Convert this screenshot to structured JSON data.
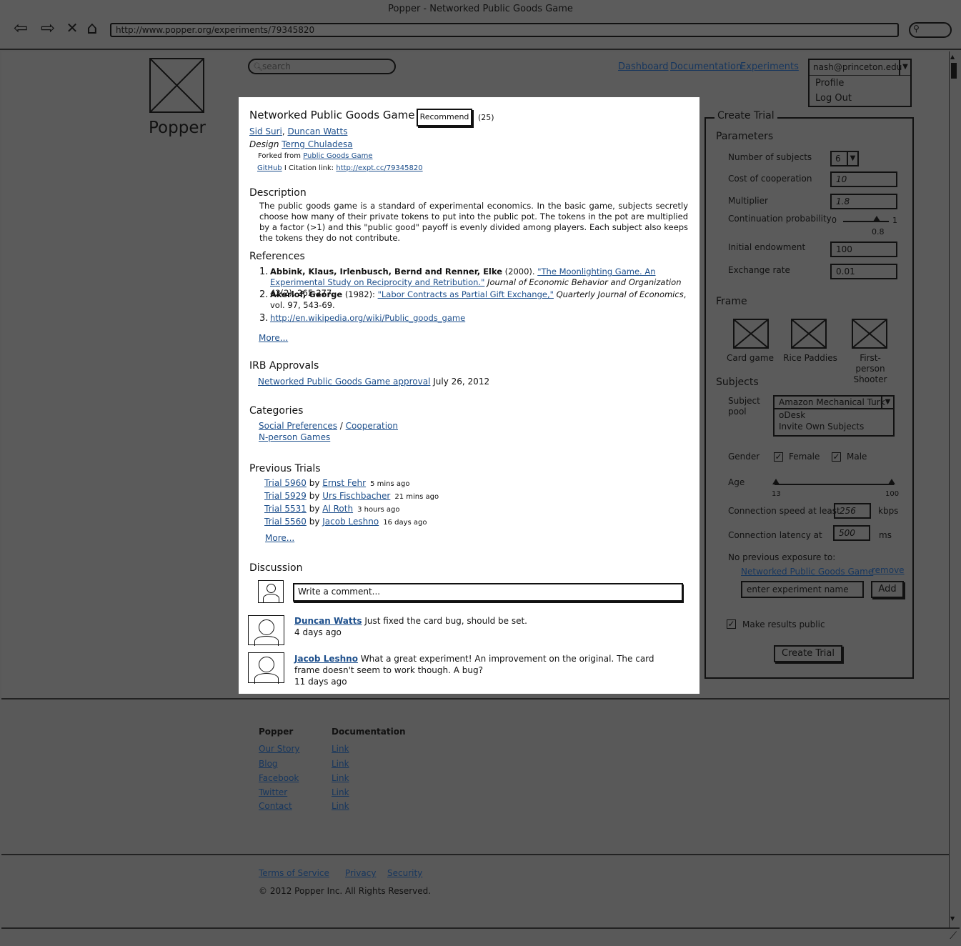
{
  "window": {
    "title": "Popper - Networked Public Goods Game",
    "url": "http://www.popper.org/experiments/79345820"
  },
  "site": {
    "name": "Popper",
    "search_placeholder": "search",
    "nav": [
      "Dashboard",
      "Documentation",
      "Experiments"
    ],
    "user": {
      "email": "nash@princeton.edu",
      "menu": [
        "Profile",
        "Log Out"
      ]
    }
  },
  "experiment": {
    "title": "Networked Public Goods Game",
    "recommend_label": "Recommend",
    "recommend_count": "(25)",
    "authors": [
      "Sid Suri",
      "Duncan Watts"
    ],
    "design_label": "Design",
    "designer": "Terng Chuladesa",
    "forked_label": "Forked from",
    "forked_from": "Public Goods Game",
    "github": "GitHub",
    "citation_label": "I Citation link:",
    "citation_url": "http://expt.cc/79345820",
    "description_heading": "Description",
    "description": "The public goods game is a standard of experimental economics. In the basic game, subjects secretly choose how many of their private tokens to put into the public pot. The tokens in the pot are multiplied by a factor (>1) and this \"public good\" payoff is evenly divided among players. Each subject also keeps the tokens they do not contribute.",
    "references_heading": "References",
    "references": [
      {
        "num": "1.",
        "authors": "Abbink, Klaus, Irlenbusch, Bernd and Renner, Elke",
        "year": "(2000).",
        "title": "\"The Moonlighting Game. An Experimental Study on Reciprocity and Retribution.\"",
        "journal": "Journal of Economic Behavior and Organization",
        "rest": "42(2), 265-277."
      },
      {
        "num": "2.",
        "authors": "Akerlof, George",
        "year": "(1982):",
        "title": "\"Labor Contracts as Partial Gift Exchange,\"",
        "journal": "Quarterly Journal of Economics",
        "rest": ", vol. 97, 543-69."
      },
      {
        "num": "3.",
        "url": "http://en.wikipedia.org/wiki/Public_goods_game"
      }
    ],
    "more_label": "More...",
    "irb_heading": "IRB Approvals",
    "irb_link": "Networked Public Goods Game approval",
    "irb_date": "July 26, 2012",
    "categories_heading": "Categories",
    "categories": [
      "Social Preferences",
      "Cooperation",
      "N-person Games"
    ],
    "categories_sep": "/",
    "trials_heading": "Previous Trials",
    "trials": [
      {
        "trial": "Trial 5960",
        "by": "by",
        "user": "Ernst Fehr",
        "ago": "5 mins ago"
      },
      {
        "trial": "Trial 5929",
        "by": "by",
        "user": "Urs Fischbacher",
        "ago": "21 mins ago"
      },
      {
        "trial": "Trial 5531",
        "by": "by",
        "user": "Al Roth",
        "ago": "3 hours ago"
      },
      {
        "trial": "Trial 5560",
        "by": "by",
        "user": "Jacob Leshno",
        "ago": "16 days ago"
      }
    ],
    "discussion_heading": "Discussion",
    "comment_placeholder": "Write a comment...",
    "comments": [
      {
        "user": "Duncan Watts",
        "text": "Just fixed the card bug, should be set.",
        "ago": "4 days ago"
      },
      {
        "user": "Jacob Leshno",
        "text": "What a great experiment! An improvement on the original. The card frame doesn't seem to work though. A bug?",
        "ago": "11 days ago"
      }
    ]
  },
  "create_trial": {
    "title": "Create Trial",
    "parameters_heading": "Parameters",
    "num_subjects_label": "Number of subjects",
    "num_subjects": "6",
    "cost_label": "Cost of cooperation",
    "cost": "10",
    "multiplier_label": "Multiplier",
    "multiplier": "1.8",
    "continuation_label": "Continuation probability",
    "continuation_min": "0",
    "continuation_max": "1",
    "continuation_value": "0.8",
    "endowment_label": "Initial endowment",
    "endowment": "100",
    "exchange_label": "Exchange rate",
    "exchange": "0.01",
    "frame_heading": "Frame",
    "frames": [
      "Card game",
      "Rice Paddies",
      "First-person Shooter"
    ],
    "subjects_heading": "Subjects",
    "pool_label": "Subject pool",
    "pool_selected": "Amazon Mechanical Turk",
    "pool_options": [
      "oDesk",
      "Invite Own Subjects"
    ],
    "gender_label": "Gender",
    "gender_female": "Female",
    "gender_male": "Male",
    "age_label": "Age",
    "age_min": "13",
    "age_max": "100",
    "speed_label": "Connection speed at least",
    "speed": "256",
    "speed_unit": "kbps",
    "latency_label": "Connection latency at",
    "latency": "500",
    "latency_unit": "ms",
    "exposure_label": "No previous exposure to:",
    "exposure_item": "Networked Public Goods Game",
    "remove_label": "remove",
    "exposure_placeholder": "enter experiment name",
    "add_label": "Add",
    "public_label": "Make results public",
    "create_label": "Create Trial"
  },
  "footer": {
    "col1_heading": "Popper",
    "col1_links": [
      "Our Story",
      "Blog",
      "Facebook",
      "Twitter",
      "Contact"
    ],
    "col2_heading": "Documentation",
    "col2_links": [
      "Link",
      "Link",
      "Link",
      "Link",
      "Link"
    ],
    "legal_links": [
      "Terms of Service",
      "Privacy",
      "Security"
    ],
    "copyright": "© 2012 Popper Inc. All Rights Reserved."
  }
}
